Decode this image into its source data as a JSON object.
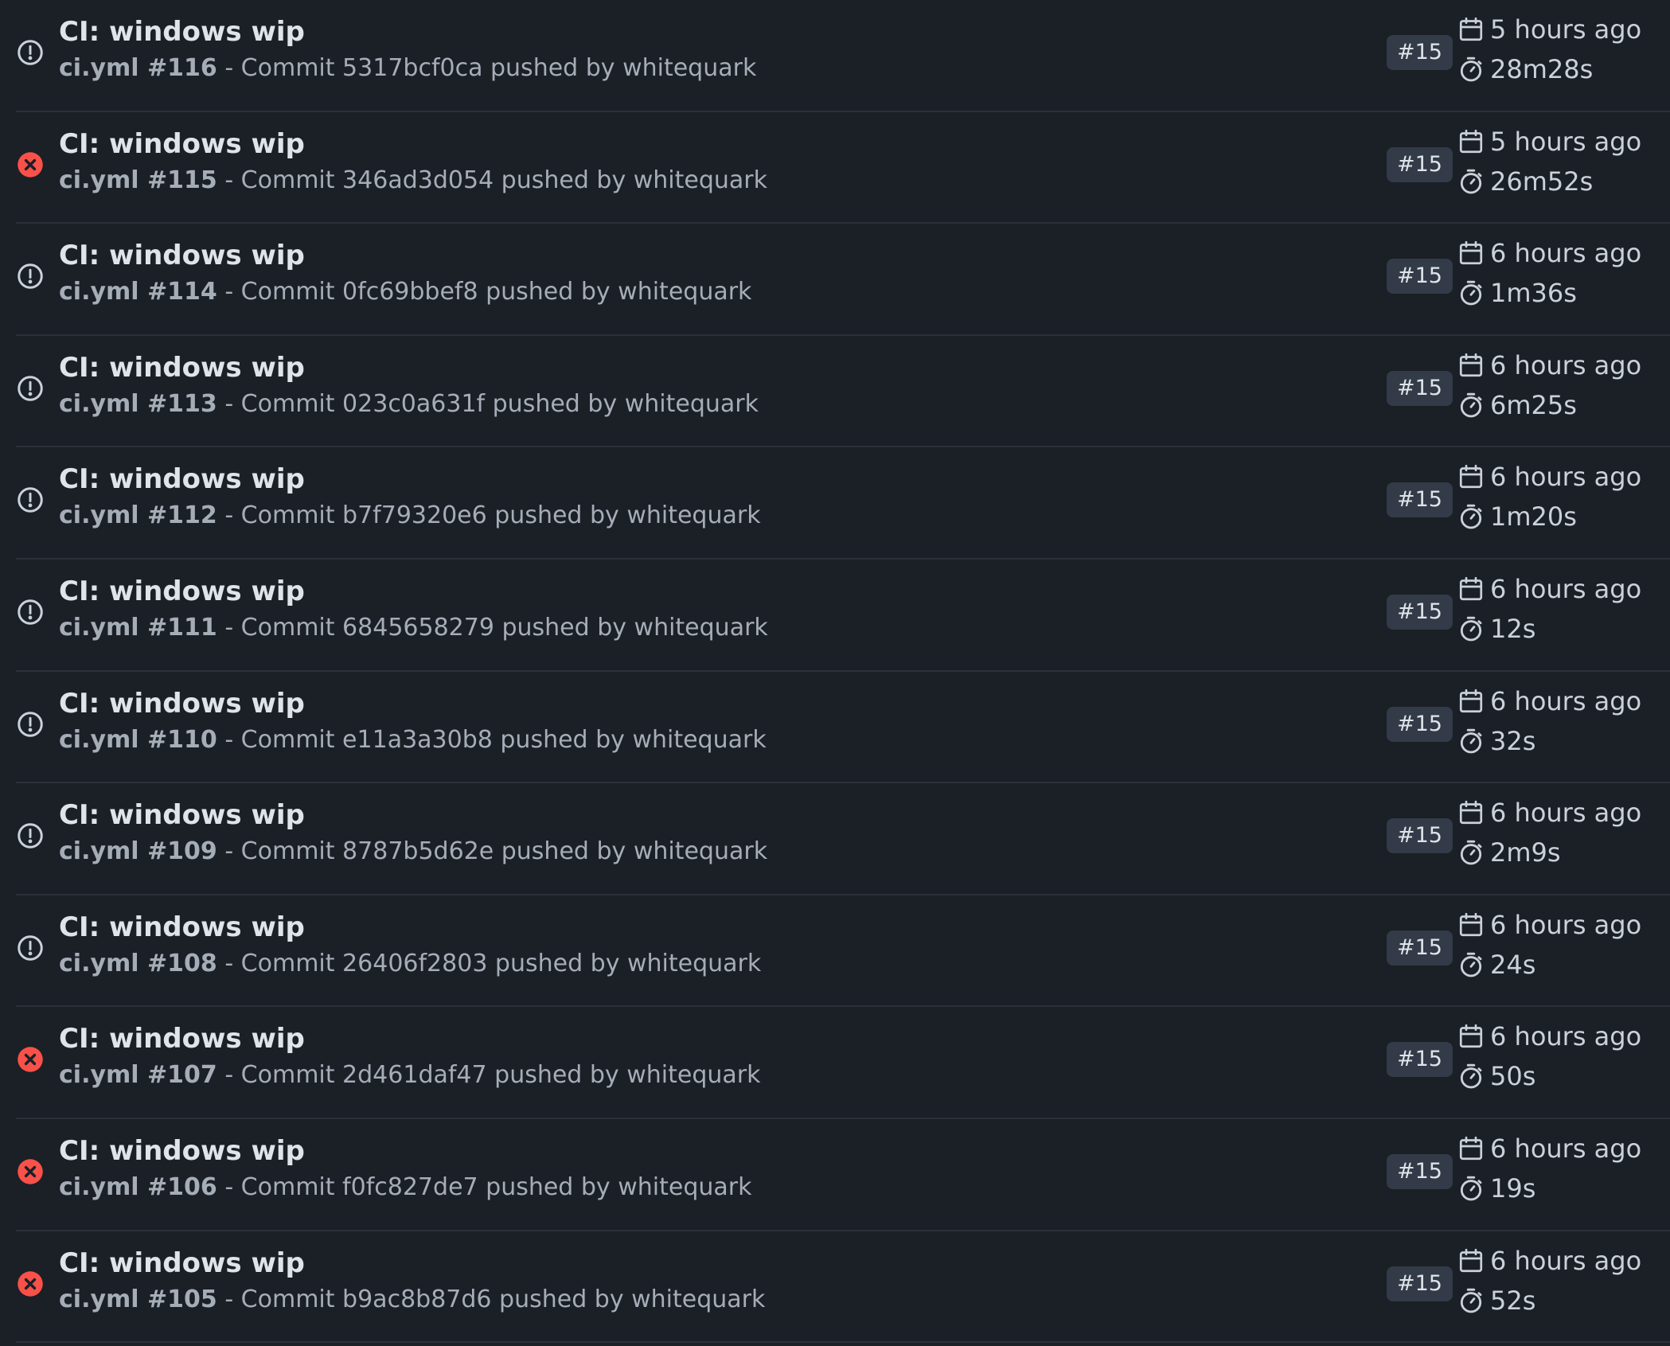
{
  "colors": {
    "background": "#1b1f26",
    "divider": "#2b313a",
    "failure": "#f85149",
    "neutral_icon": "#c9d1d9",
    "badge_bg": "#323b47"
  },
  "runs": [
    {
      "status": "neutral",
      "status_icon": "alert-circle-icon",
      "title": "CI: windows wip",
      "workflow": "ci.yml #116",
      "commit_text": "- Commit 5317bcf0ca pushed by whitequark",
      "badge": "#15",
      "ago": "5 hours ago",
      "duration": "28m28s"
    },
    {
      "status": "failure",
      "status_icon": "x-circle-fill-icon",
      "title": "CI: windows wip",
      "workflow": "ci.yml #115",
      "commit_text": "- Commit 346ad3d054 pushed by whitequark",
      "badge": "#15",
      "ago": "5 hours ago",
      "duration": "26m52s"
    },
    {
      "status": "neutral",
      "status_icon": "alert-circle-icon",
      "title": "CI: windows wip",
      "workflow": "ci.yml #114",
      "commit_text": "- Commit 0fc69bbef8 pushed by whitequark",
      "badge": "#15",
      "ago": "6 hours ago",
      "duration": "1m36s"
    },
    {
      "status": "neutral",
      "status_icon": "alert-circle-icon",
      "title": "CI: windows wip",
      "workflow": "ci.yml #113",
      "commit_text": "- Commit 023c0a631f pushed by whitequark",
      "badge": "#15",
      "ago": "6 hours ago",
      "duration": "6m25s"
    },
    {
      "status": "neutral",
      "status_icon": "alert-circle-icon",
      "title": "CI: windows wip",
      "workflow": "ci.yml #112",
      "commit_text": "- Commit b7f79320e6 pushed by whitequark",
      "badge": "#15",
      "ago": "6 hours ago",
      "duration": "1m20s"
    },
    {
      "status": "neutral",
      "status_icon": "alert-circle-icon",
      "title": "CI: windows wip",
      "workflow": "ci.yml #111",
      "commit_text": "- Commit 6845658279 pushed by whitequark",
      "badge": "#15",
      "ago": "6 hours ago",
      "duration": "12s"
    },
    {
      "status": "neutral",
      "status_icon": "alert-circle-icon",
      "title": "CI: windows wip",
      "workflow": "ci.yml #110",
      "commit_text": "- Commit e11a3a30b8 pushed by whitequark",
      "badge": "#15",
      "ago": "6 hours ago",
      "duration": "32s"
    },
    {
      "status": "neutral",
      "status_icon": "alert-circle-icon",
      "title": "CI: windows wip",
      "workflow": "ci.yml #109",
      "commit_text": "- Commit 8787b5d62e pushed by whitequark",
      "badge": "#15",
      "ago": "6 hours ago",
      "duration": "2m9s"
    },
    {
      "status": "neutral",
      "status_icon": "alert-circle-icon",
      "title": "CI: windows wip",
      "workflow": "ci.yml #108",
      "commit_text": "- Commit 26406f2803 pushed by whitequark",
      "badge": "#15",
      "ago": "6 hours ago",
      "duration": "24s"
    },
    {
      "status": "failure",
      "status_icon": "x-circle-fill-icon",
      "title": "CI: windows wip",
      "workflow": "ci.yml #107",
      "commit_text": "- Commit 2d461daf47 pushed by whitequark",
      "badge": "#15",
      "ago": "6 hours ago",
      "duration": "50s"
    },
    {
      "status": "failure",
      "status_icon": "x-circle-fill-icon",
      "title": "CI: windows wip",
      "workflow": "ci.yml #106",
      "commit_text": "- Commit f0fc827de7 pushed by whitequark",
      "badge": "#15",
      "ago": "6 hours ago",
      "duration": "19s"
    },
    {
      "status": "failure",
      "status_icon": "x-circle-fill-icon",
      "title": "CI: windows wip",
      "workflow": "ci.yml #105",
      "commit_text": "- Commit b9ac8b87d6 pushed by whitequark",
      "badge": "#15",
      "ago": "6 hours ago",
      "duration": "52s"
    }
  ]
}
